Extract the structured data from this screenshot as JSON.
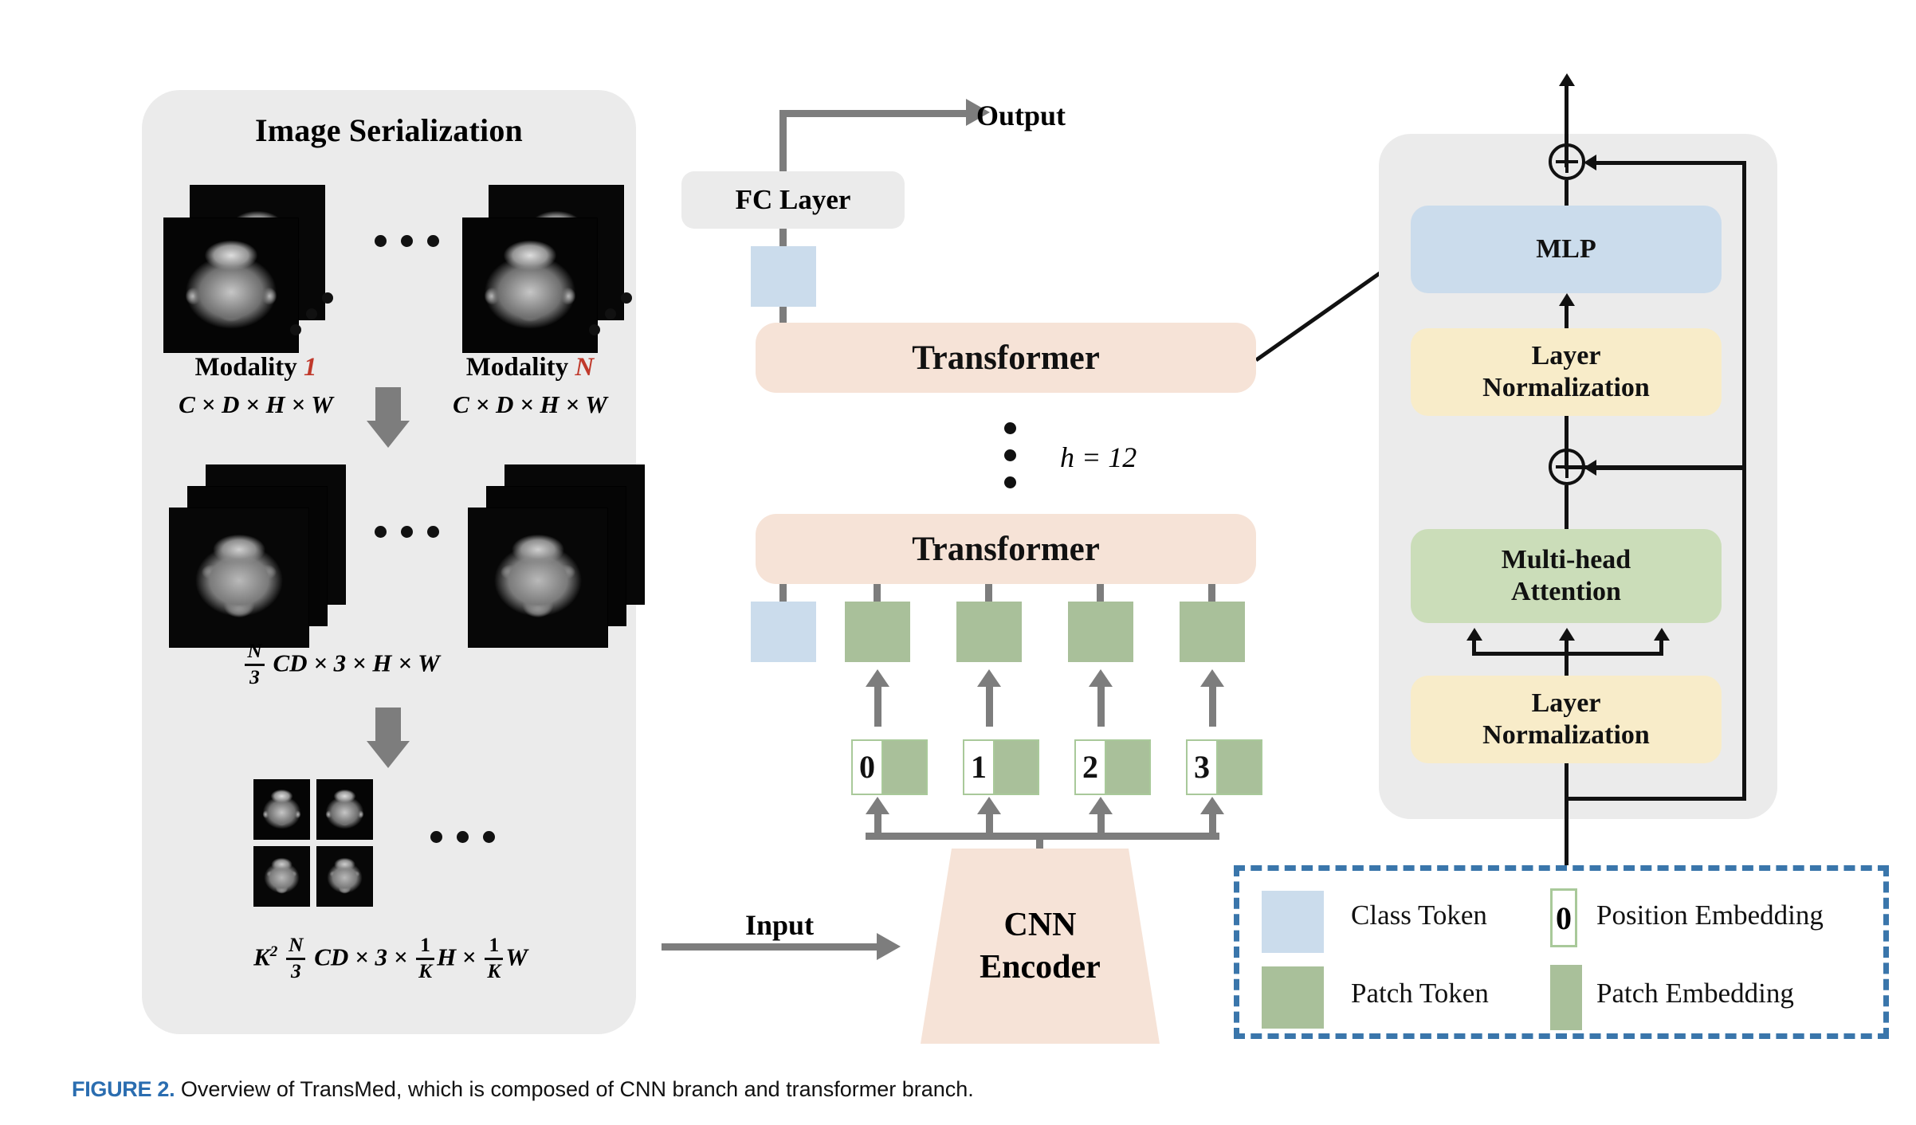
{
  "figure": {
    "tag": "FIGURE 2.",
    "caption": "Overview of TransMed, which is composed of CNN branch and transformer branch."
  },
  "serialization": {
    "title": "Image Serialization",
    "modality_first": {
      "prefix": "Modality",
      "index": "1"
    },
    "modality_last": {
      "prefix": "Modality",
      "index": "N"
    },
    "shape_modality": "C × D × H × W",
    "shape_merged": {
      "num": "N",
      "den": "3",
      "tail": "CD × 3 × H × W"
    },
    "shape_patched": {
      "k2": "K",
      "k2_exp": "2",
      "num": "N",
      "den": "3",
      "mid": "CD × 3 ×",
      "f1n": "1",
      "f1d": "K",
      "h": "H",
      "x": "×",
      "f2n": "1",
      "f2d": "K",
      "w": "W"
    },
    "ellipsis": "• • •"
  },
  "pipeline": {
    "output_label": "Output",
    "fc_layer_label": "FC Layer",
    "transformer_label": "Transformer",
    "depth_label": "h = 12",
    "input_label": "Input",
    "cnn_encoder_line1": "CNN",
    "cnn_encoder_line2": "Encoder",
    "position_tokens": [
      "0",
      "1",
      "2",
      "3"
    ]
  },
  "transformer_detail": {
    "mlp_label": "MLP",
    "layer_norm_label": "Layer\nNormalization",
    "layer_norm_line1": "Layer",
    "layer_norm_line2": "Normalization",
    "mha_line1": "Multi-head",
    "mha_line2": "Attention",
    "add_symbol": "⊕"
  },
  "legend": {
    "items": [
      {
        "label": "Class Token",
        "swatch": "class-token"
      },
      {
        "label": "Position Embedding",
        "swatch": "position-embedding",
        "glyph": "0"
      },
      {
        "label": "Patch Token",
        "swatch": "patch-token"
      },
      {
        "label": "Patch Embedding",
        "swatch": "patch-embedding"
      }
    ]
  },
  "colors": {
    "panel_grey": "#ebebeb",
    "transformer_peach": "#f6e3d7",
    "class_token_blue": "#cbdcec",
    "patch_token_green": "#a9c09a",
    "mha_green": "#cbddb9",
    "layer_norm_yellow": "#f8ecc9",
    "arrow_grey": "#7d7d7d",
    "legend_border_blue": "#3a76ab",
    "caption_blue": "#2a6db0",
    "modality_index_red": "#c0392b"
  }
}
